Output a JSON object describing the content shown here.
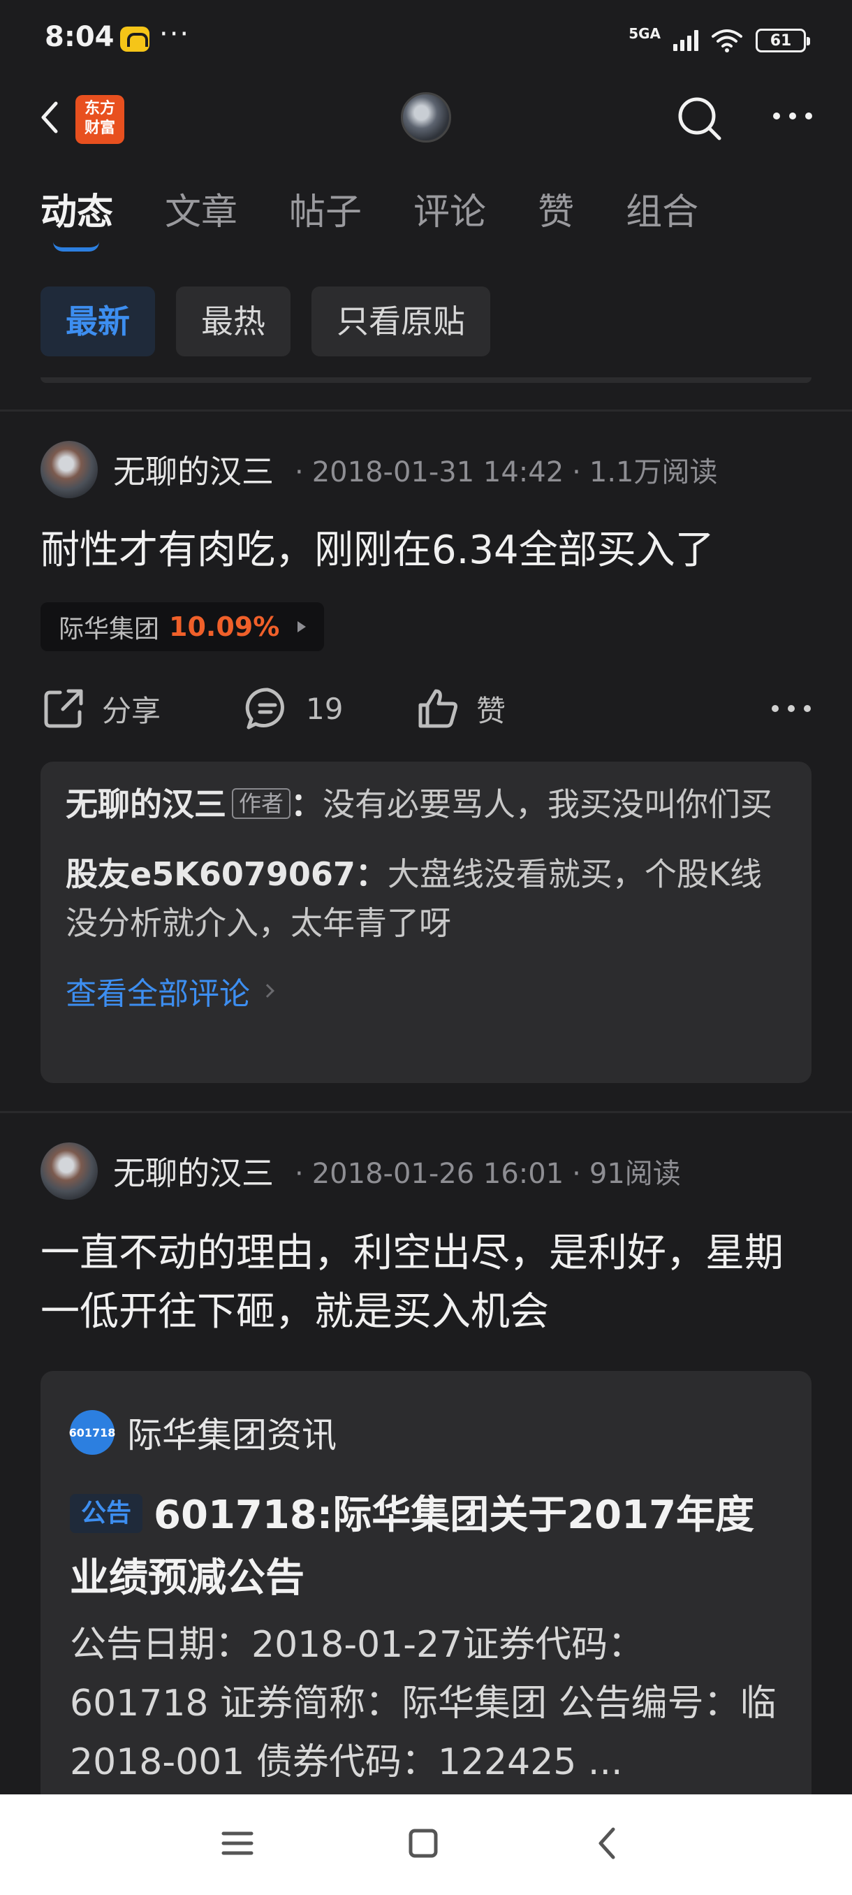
{
  "status": {
    "time": "8:04",
    "dots": "···",
    "network": "5GA",
    "battery": "61"
  },
  "header": {
    "logo_text": "东方\n财富"
  },
  "tabs": [
    "动态",
    "文章",
    "帖子",
    "评论",
    "赞",
    "组合"
  ],
  "filters": [
    "最新",
    "最热",
    "只看原贴"
  ],
  "post1": {
    "author": "无聊的汉三",
    "date": "2018-01-31 14:42",
    "reads": "1.1万阅读",
    "text": "耐性才有肉吃，刚刚在6.34全部买入了",
    "stock_name": "际华集团",
    "stock_pct": "10.09%",
    "share_label": "分享",
    "comment_count": "19",
    "like_label": "赞",
    "comments": [
      {
        "author": "无聊的汉三",
        "badge": "作者",
        "text": "没有必要骂人，我买没叫你们买"
      },
      {
        "author": "股友e5K6079067",
        "text": "大盘线没看就买，个股K线没分析就介入，太年青了呀"
      }
    ],
    "view_all": "查看全部评论"
  },
  "post2": {
    "author": "无聊的汉三",
    "date": "2018-01-26 16:01",
    "reads": "91阅读",
    "text": "一直不动的理由，利空出尽，是利好，星期一低开往下砸，就是买入机会",
    "card": {
      "logo_text": "601718",
      "source": "际华集团资讯",
      "badge": "公告",
      "title": "601718:际华集团关于2017年度业绩预减公告",
      "body": "公告日期：2018-01-27证券代码：601718 证券简称：际华集团 公告编号：临2018-001 债券代码：122425 ..."
    }
  },
  "colors": {
    "background": "#1c1c1e",
    "accent_blue": "#2c7fe0",
    "rise_red": "#f0602a",
    "card": "#2c2c2e"
  }
}
